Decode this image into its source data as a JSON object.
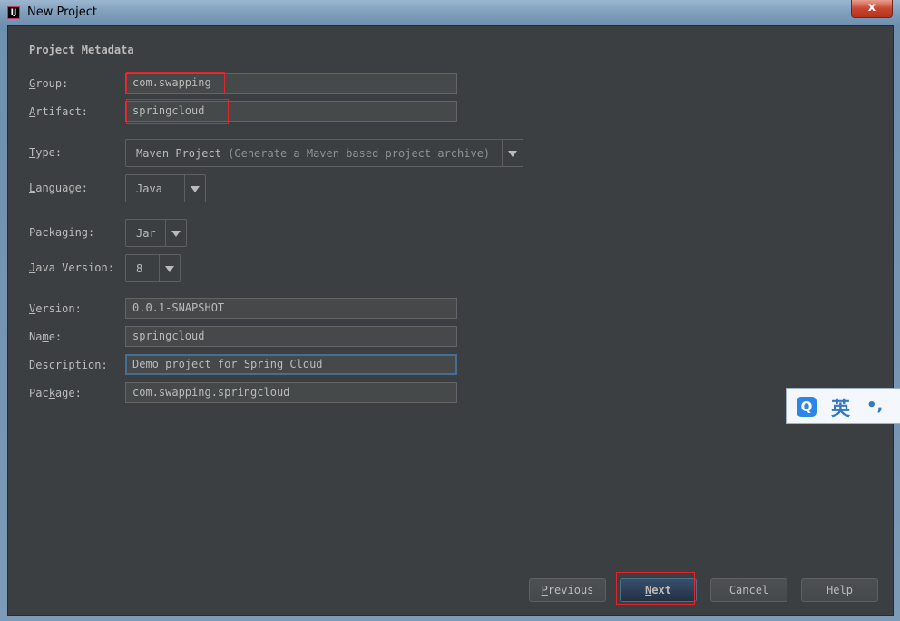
{
  "window": {
    "title": "New Project",
    "icon_glyph": "IJ",
    "close_glyph": "x"
  },
  "section_title": "Project Metadata",
  "form": {
    "group": {
      "label_pre": "",
      "label_key": "G",
      "label_post": "roup:",
      "value": "com.swapping"
    },
    "artifact": {
      "label_pre": "",
      "label_key": "A",
      "label_post": "rtifact:",
      "value": "springcloud"
    },
    "type": {
      "label_pre": "",
      "label_key": "T",
      "label_post": "ype:",
      "value": "Maven Project",
      "hint": "(Generate a Maven based project archive)"
    },
    "language": {
      "label_pre": "",
      "label_key": "L",
      "label_post": "anguage:",
      "value": "Java"
    },
    "packaging": {
      "label": "Packaging:",
      "value": "Jar"
    },
    "java_version": {
      "label_pre": "",
      "label_key": "J",
      "label_post": "ava Version:",
      "value": "8"
    },
    "version": {
      "label_pre": "",
      "label_key": "V",
      "label_post": "ersion:",
      "value": "0.0.1-SNAPSHOT"
    },
    "name": {
      "label_pre": "Na",
      "label_key": "m",
      "label_post": "e:",
      "value": "springcloud"
    },
    "description": {
      "label_pre": "",
      "label_key": "D",
      "label_post": "escription:",
      "value": "Demo project for Spring Cloud"
    },
    "package": {
      "label_pre": "Pac",
      "label_key": "k",
      "label_post": "age:",
      "value": "com.swapping.springcloud"
    }
  },
  "buttons": {
    "previous": {
      "key": "P",
      "rest": "revious"
    },
    "next": {
      "key": "N",
      "rest": "ext"
    },
    "cancel": {
      "label": "Cancel"
    },
    "help": {
      "label": "Help"
    }
  },
  "ime": {
    "logo": "Q",
    "lang": "英",
    "punct": "•,"
  },
  "colors": {
    "background": "#3c3f41",
    "text": "#bbbbbb",
    "highlight_box": "#e0262a",
    "focus_border": "#466d94",
    "default_button": "#2b3e55"
  },
  "icons": [
    "app-logo-icon",
    "close-icon",
    "dropdown-arrow-icon",
    "ime-logo-icon"
  ]
}
